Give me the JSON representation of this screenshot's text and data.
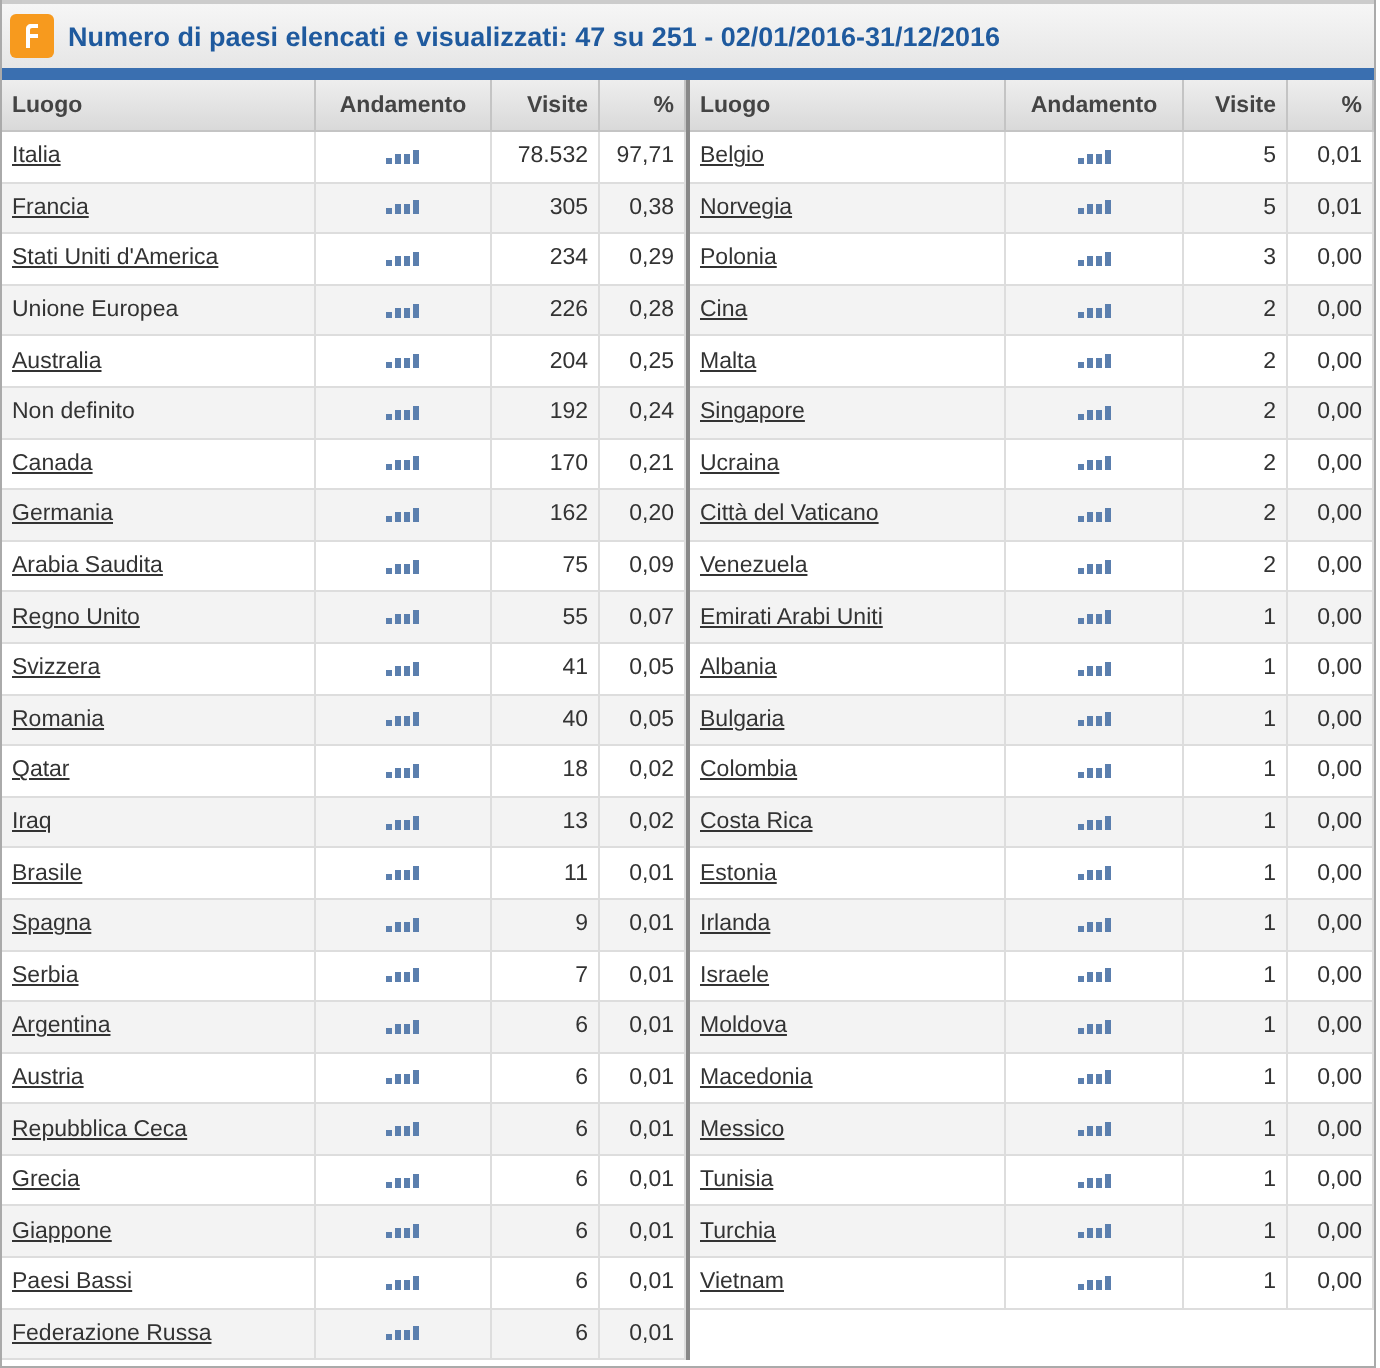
{
  "panel": {
    "title": "Numero di paesi elencati e visualizzati: 47 su 251 - 02/01/2016-31/12/2016"
  },
  "tables": [
    {
      "columns": [
        "Luogo",
        "Andamento",
        "Visite",
        "%"
      ],
      "rows": [
        {
          "place": "Italia",
          "link": true,
          "visits": "78.532",
          "percent": "97,71"
        },
        {
          "place": "Francia",
          "link": true,
          "visits": "305",
          "percent": "0,38"
        },
        {
          "place": "Stati Uniti d'America",
          "link": true,
          "visits": "234",
          "percent": "0,29"
        },
        {
          "place": "Unione Europea",
          "link": false,
          "visits": "226",
          "percent": "0,28"
        },
        {
          "place": "Australia",
          "link": true,
          "visits": "204",
          "percent": "0,25"
        },
        {
          "place": "Non definito",
          "link": false,
          "visits": "192",
          "percent": "0,24"
        },
        {
          "place": "Canada",
          "link": true,
          "visits": "170",
          "percent": "0,21"
        },
        {
          "place": "Germania",
          "link": true,
          "visits": "162",
          "percent": "0,20"
        },
        {
          "place": "Arabia Saudita",
          "link": true,
          "visits": "75",
          "percent": "0,09"
        },
        {
          "place": "Regno Unito",
          "link": true,
          "visits": "55",
          "percent": "0,07"
        },
        {
          "place": "Svizzera",
          "link": true,
          "visits": "41",
          "percent": "0,05"
        },
        {
          "place": "Romania",
          "link": true,
          "visits": "40",
          "percent": "0,05"
        },
        {
          "place": "Qatar",
          "link": true,
          "visits": "18",
          "percent": "0,02"
        },
        {
          "place": "Iraq",
          "link": true,
          "visits": "13",
          "percent": "0,02"
        },
        {
          "place": "Brasile",
          "link": true,
          "visits": "11",
          "percent": "0,01"
        },
        {
          "place": "Spagna",
          "link": true,
          "visits": "9",
          "percent": "0,01"
        },
        {
          "place": "Serbia",
          "link": true,
          "visits": "7",
          "percent": "0,01"
        },
        {
          "place": "Argentina",
          "link": true,
          "visits": "6",
          "percent": "0,01"
        },
        {
          "place": "Austria",
          "link": true,
          "visits": "6",
          "percent": "0,01"
        },
        {
          "place": "Repubblica Ceca",
          "link": true,
          "visits": "6",
          "percent": "0,01"
        },
        {
          "place": "Grecia",
          "link": true,
          "visits": "6",
          "percent": "0,01"
        },
        {
          "place": "Giappone",
          "link": true,
          "visits": "6",
          "percent": "0,01"
        },
        {
          "place": "Paesi Bassi",
          "link": true,
          "visits": "6",
          "percent": "0,01"
        },
        {
          "place": "Federazione Russa",
          "link": true,
          "visits": "6",
          "percent": "0,01"
        }
      ]
    },
    {
      "columns": [
        "Luogo",
        "Andamento",
        "Visite",
        "%"
      ],
      "rows": [
        {
          "place": "Belgio",
          "link": true,
          "visits": "5",
          "percent": "0,01"
        },
        {
          "place": "Norvegia",
          "link": true,
          "visits": "5",
          "percent": "0,01"
        },
        {
          "place": "Polonia",
          "link": true,
          "visits": "3",
          "percent": "0,00"
        },
        {
          "place": "Cina",
          "link": true,
          "visits": "2",
          "percent": "0,00"
        },
        {
          "place": "Malta",
          "link": true,
          "visits": "2",
          "percent": "0,00"
        },
        {
          "place": "Singapore",
          "link": true,
          "visits": "2",
          "percent": "0,00"
        },
        {
          "place": "Ucraina",
          "link": true,
          "visits": "2",
          "percent": "0,00"
        },
        {
          "place": "Città del Vaticano",
          "link": true,
          "visits": "2",
          "percent": "0,00"
        },
        {
          "place": "Venezuela",
          "link": true,
          "visits": "2",
          "percent": "0,00"
        },
        {
          "place": "Emirati Arabi Uniti",
          "link": true,
          "visits": "1",
          "percent": "0,00"
        },
        {
          "place": "Albania",
          "link": true,
          "visits": "1",
          "percent": "0,00"
        },
        {
          "place": "Bulgaria",
          "link": true,
          "visits": "1",
          "percent": "0,00"
        },
        {
          "place": "Colombia",
          "link": true,
          "visits": "1",
          "percent": "0,00"
        },
        {
          "place": "Costa Rica",
          "link": true,
          "visits": "1",
          "percent": "0,00"
        },
        {
          "place": "Estonia",
          "link": true,
          "visits": "1",
          "percent": "0,00"
        },
        {
          "place": "Irlanda",
          "link": true,
          "visits": "1",
          "percent": "0,00"
        },
        {
          "place": "Israele",
          "link": true,
          "visits": "1",
          "percent": "0,00"
        },
        {
          "place": "Moldova",
          "link": true,
          "visits": "1",
          "percent": "0,00"
        },
        {
          "place": "Macedonia",
          "link": true,
          "visits": "1",
          "percent": "0,00"
        },
        {
          "place": "Messico",
          "link": true,
          "visits": "1",
          "percent": "0,00"
        },
        {
          "place": "Tunisia",
          "link": true,
          "visits": "1",
          "percent": "0,00"
        },
        {
          "place": "Turchia",
          "link": true,
          "visits": "1",
          "percent": "0,00"
        },
        {
          "place": "Vietnam",
          "link": true,
          "visits": "1",
          "percent": "0,00"
        }
      ]
    }
  ]
}
